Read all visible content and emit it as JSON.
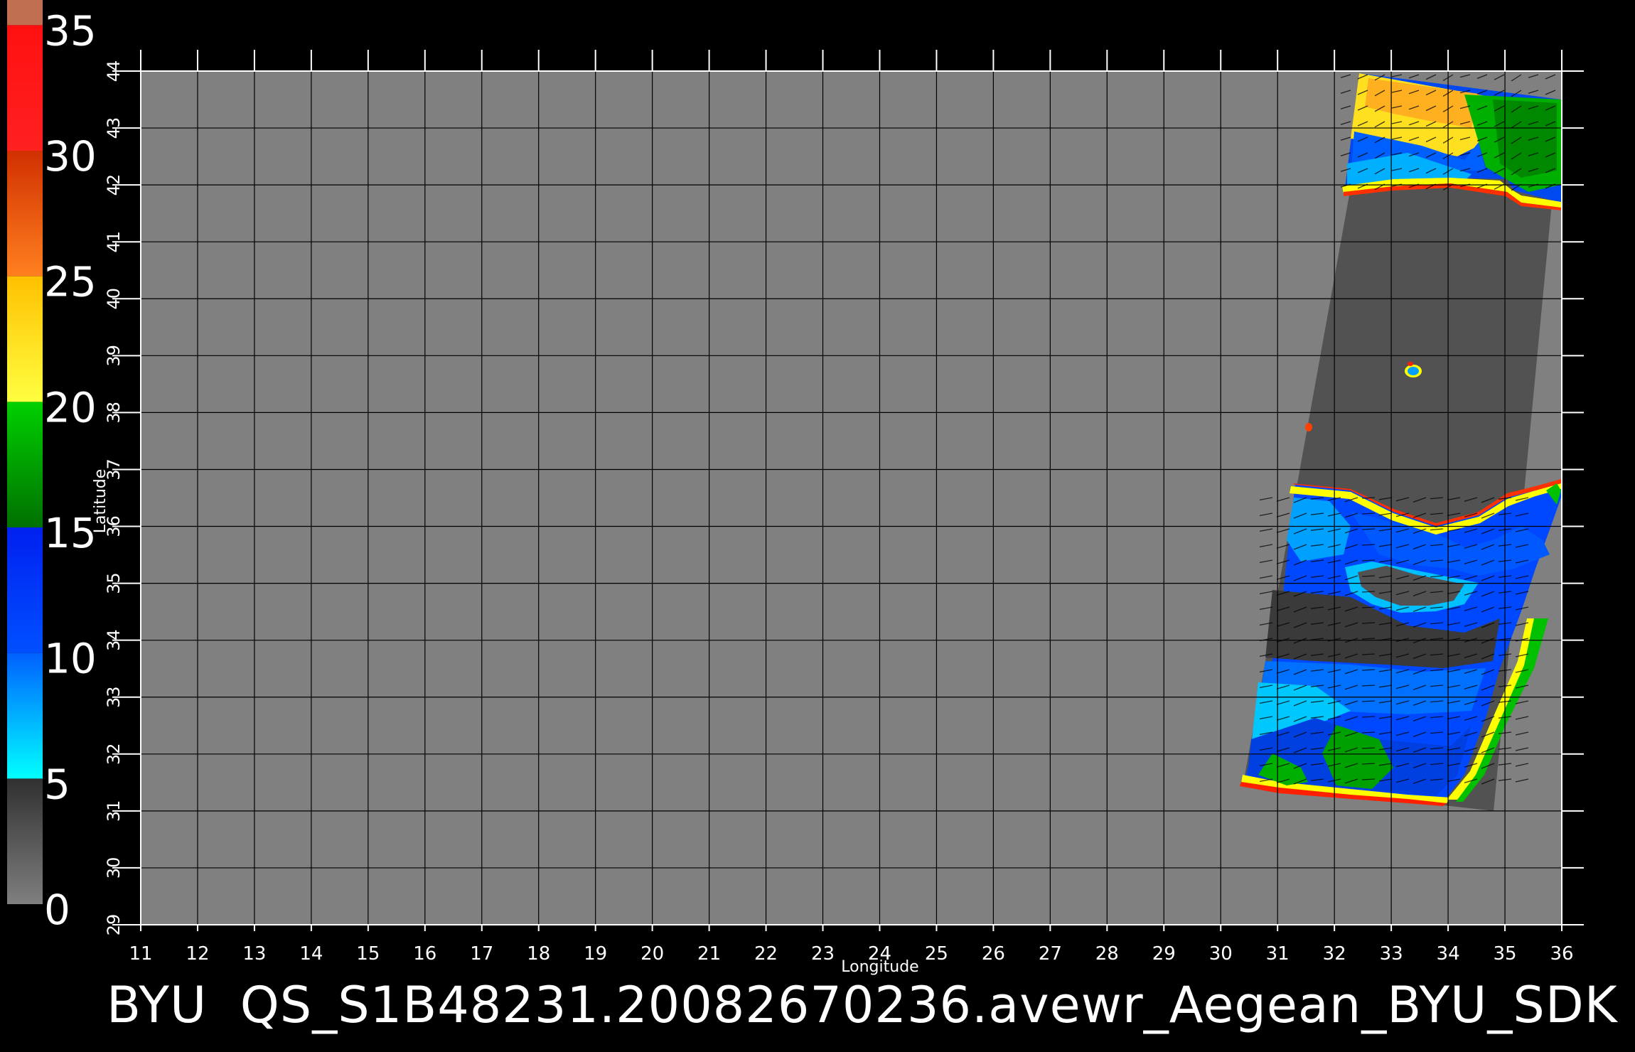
{
  "title": "BYU  QS_S1B48231.20082670236.avewr_Aegean_BYU_SDK",
  "colorbar": {
    "ticks": [
      "0",
      "5",
      "10",
      "15",
      "20",
      "25",
      "30",
      "35"
    ],
    "segments": [
      {
        "from": 0,
        "to": 5,
        "colors": [
          "#7f7f7f",
          "#303030"
        ]
      },
      {
        "from": 5,
        "to": 10,
        "colors": [
          "#00ffff",
          "#0060ff"
        ]
      },
      {
        "from": 10,
        "to": 15,
        "colors": [
          "#0050ff",
          "#0020f0"
        ]
      },
      {
        "from": 15,
        "to": 20,
        "colors": [
          "#007000",
          "#00d000"
        ]
      },
      {
        "from": 20,
        "to": 25,
        "colors": [
          "#ffff40",
          "#ffc000"
        ]
      },
      {
        "from": 25,
        "to": 30,
        "colors": [
          "#ff8020",
          "#d03000"
        ]
      },
      {
        "from": 30,
        "to": 35,
        "colors": [
          "#ff2020",
          "#ff1010"
        ]
      },
      {
        "from": 35,
        "to": 36,
        "colors": [
          "#c07050",
          "#c07050"
        ]
      }
    ]
  },
  "map": {
    "xlabel": "Longitude",
    "ylabel": "Latitude",
    "lon_range": [
      11,
      36
    ],
    "lat_range": [
      29,
      44
    ],
    "lon_ticks": [
      "11",
      "12",
      "13",
      "14",
      "15",
      "16",
      "17",
      "18",
      "19",
      "20",
      "21",
      "22",
      "23",
      "24",
      "25",
      "26",
      "27",
      "28",
      "29",
      "30",
      "31",
      "32",
      "33",
      "34",
      "35",
      "36"
    ],
    "lat_ticks": [
      "29",
      "30",
      "31",
      "32",
      "33",
      "34",
      "35",
      "36",
      "37",
      "38",
      "39",
      "40",
      "41",
      "42",
      "43",
      "44"
    ],
    "background_color": "#808080",
    "land_color": "#505050",
    "swath_corners_lonlat": [
      [
        32.6,
        43.7
      ],
      [
        36.0,
        43.5
      ],
      [
        34.8,
        31.0
      ],
      [
        30.4,
        31.5
      ]
    ],
    "colors": {
      "ocean_low": "#0040ff",
      "ocean_mid": "#00a0ff",
      "coast_yellow": "#ffff00",
      "coast_red": "#ff2000",
      "coast_green": "#00c000",
      "coast_magenta": "#ff40ff"
    }
  }
}
